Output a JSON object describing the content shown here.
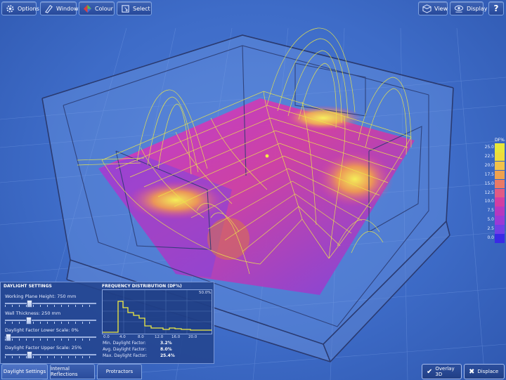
{
  "toolbar": {
    "options_label": "Options",
    "windows_label": "Windows",
    "colour_label": "Colour",
    "select_label": "Select",
    "view_label": "View",
    "display_label": "Display",
    "help_label": "?"
  },
  "legend": {
    "title": "DF%",
    "values": [
      "25.0",
      "22.5",
      "20.0",
      "17.5",
      "15.0",
      "12.5",
      "10.0",
      "7.5",
      "5.0",
      "2.5",
      "0.0"
    ],
    "colors": [
      "#e6e63a",
      "#eedc3a",
      "#f2c24a",
      "#f0a24e",
      "#ea7a66",
      "#e25a84",
      "#d23ea2",
      "#b638bf",
      "#9a3ad6",
      "#7040e6",
      "#3a2ae6"
    ]
  },
  "panel": {
    "title": "DAYLIGHT SETTINGS",
    "sliders": [
      {
        "label": "Working Plane Height: 750 mm",
        "position": 0.25
      },
      {
        "label": "Wall Thickness: 250 mm",
        "position": 0.24
      },
      {
        "label": "Daylight Factor Lower Scale: 0%",
        "position": 0.01
      },
      {
        "label": "Daylight Factor Upper Scale: 25%",
        "position": 0.25
      }
    ]
  },
  "frequency": {
    "title": "FREQUENCY DISTRIBUTION (DF%)",
    "max_label": "50.0%",
    "ticks": [
      "0.0",
      "4.0",
      "8.0",
      "12.0",
      "16.0",
      "20.0"
    ],
    "stats": [
      {
        "label": "Min. Daylight Factor:",
        "value": "3.2%"
      },
      {
        "label": "Avg. Daylight Factor:",
        "value": "8.0%"
      },
      {
        "label": "Max. Daylight Factor:",
        "value": "25.4%"
      }
    ]
  },
  "tabs": {
    "daylight_settings": "Daylight Settings",
    "internal_reflections": "Internal Reflections",
    "protractors": "Protractors"
  },
  "bottom_buttons": {
    "overlay_label": "Overlay 3D",
    "displace_label": "Displace"
  }
}
